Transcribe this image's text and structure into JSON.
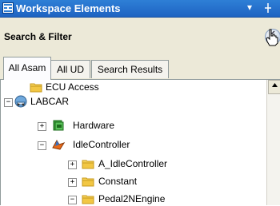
{
  "window": {
    "title": "Workspace Elements",
    "menu_glyph": "▾",
    "pin_glyph": "ꟷ"
  },
  "panel": {
    "title": "Search & Filter",
    "expander_glyph": "»"
  },
  "tabs": [
    {
      "label": "All Asam",
      "active": true
    },
    {
      "label": "All UD",
      "active": false
    },
    {
      "label": "Search Results",
      "active": false
    }
  ],
  "tree": {
    "nodes": [
      {
        "label": "ECU Access",
        "expander": "",
        "icon": "folder-icon"
      },
      {
        "label": "LABCAR",
        "expander": "−",
        "icon": "labcar-icon"
      },
      {
        "label": "Hardware",
        "expander": "+",
        "icon": "hardware-icon"
      },
      {
        "label": "IdleController",
        "expander": "−",
        "icon": "simulink-icon"
      },
      {
        "label": "A_IdleController",
        "expander": "+",
        "icon": "folder-icon"
      },
      {
        "label": "Constant",
        "expander": "+",
        "icon": "folder-icon"
      },
      {
        "label": "Pedal2NEngine",
        "expander": "−",
        "icon": "folder-icon"
      }
    ]
  },
  "colors": {
    "titlebar": "#1e63c2",
    "folder": "#f2c744",
    "panel_bg": "#ece9d8"
  }
}
